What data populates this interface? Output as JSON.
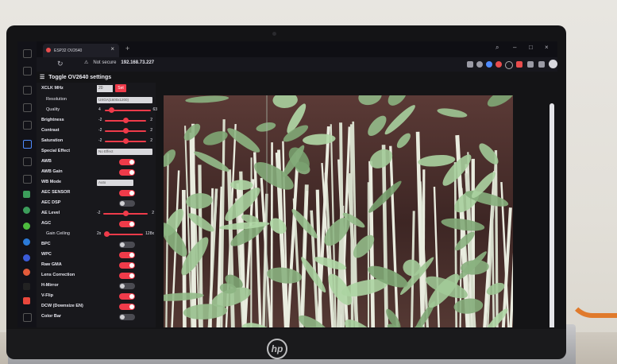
{
  "browser": {
    "tab_title": "ESP32 OV2640",
    "tab_close": "×",
    "new_tab": "+",
    "security_label": "Not secure",
    "url": "192.168.73.227"
  },
  "page": {
    "title": "Toggle OV2640 settings"
  },
  "settings": {
    "xclk": {
      "label": "XCLK MHz",
      "value": "20",
      "button": "Set"
    },
    "resolution": {
      "label": "Resolution",
      "value": "UXGA(1600x1200)"
    },
    "quality": {
      "label": "Quality",
      "min": "4",
      "max": "63",
      "level": 0.15
    },
    "brightness": {
      "label": "Brightness",
      "min": "-2",
      "max": "2",
      "level": 0.5
    },
    "contrast": {
      "label": "Contrast",
      "min": "-2",
      "max": "2",
      "level": 0.5
    },
    "saturation": {
      "label": "Saturation",
      "min": "-2",
      "max": "2",
      "level": 0.5
    },
    "special_effect": {
      "label": "Special Effect",
      "value": "No Effect"
    },
    "awb": {
      "label": "AWB",
      "on": true
    },
    "awb_gain": {
      "label": "AWB Gain",
      "on": true
    },
    "wb_mode": {
      "label": "WB Mode",
      "value": "Auto"
    },
    "aec_sensor": {
      "label": "AEC SENSOR",
      "on": true
    },
    "aec_dsp": {
      "label": "AEC DSP",
      "on": false
    },
    "ae_level": {
      "label": "AE Level",
      "min": "-2",
      "max": "2",
      "level": 0.5
    },
    "agc": {
      "label": "AGC",
      "on": true
    },
    "gain_ceiling": {
      "label": "Gain Ceiling",
      "min": "2x",
      "max": "128x",
      "level": 0.0
    },
    "bpc": {
      "label": "BPC",
      "on": false
    },
    "wpc": {
      "label": "WPC",
      "on": true
    },
    "raw_gma": {
      "label": "Raw GMA",
      "on": true
    },
    "lens_correction": {
      "label": "Lens Correction",
      "on": true
    },
    "h_mirror": {
      "label": "H-Mirror",
      "on": false
    },
    "v_flip": {
      "label": "V-Flip",
      "on": true
    },
    "dcw": {
      "label": "DCW (Downsize EN)",
      "on": true
    },
    "color_bar": {
      "label": "Color Bar",
      "on": false
    }
  },
  "device": {
    "brand": "hp"
  },
  "colors": {
    "accent": "#ef3b4a",
    "panel": "#18181c",
    "screen": "#0c0c10"
  }
}
